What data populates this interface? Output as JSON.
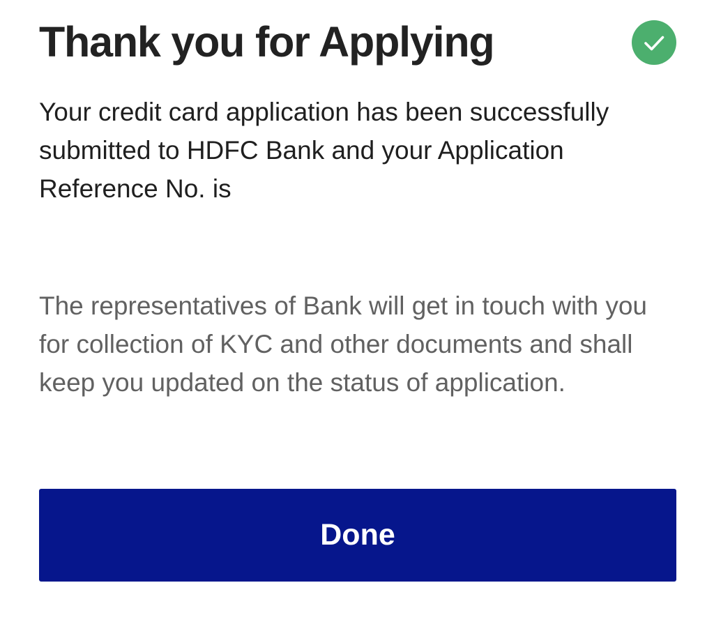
{
  "header": {
    "title": "Thank you for Applying",
    "status_icon": "check-circle-icon",
    "status_color": "#4caf6e"
  },
  "message": {
    "text": "Your credit card application has been successfully submitted to HDFC Bank and your Application Reference No. is"
  },
  "info": {
    "text": "The representatives of Bank will get in touch with you for collection of KYC and other documents and shall keep you updated on the status of application."
  },
  "actions": {
    "done_label": "Done",
    "done_color": "#06168c"
  }
}
